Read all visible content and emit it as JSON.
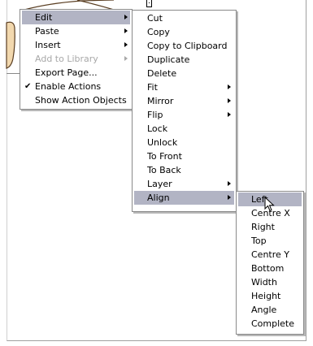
{
  "main_menu": {
    "items": [
      {
        "label": "Edit",
        "has_submenu": true,
        "state": "highlighted"
      },
      {
        "label": "Paste",
        "has_submenu": true
      },
      {
        "label": "Insert",
        "has_submenu": true
      },
      {
        "label": "Add to Library",
        "has_submenu": true,
        "state": "disabled"
      },
      {
        "label": "Export Page...",
        "has_submenu": false
      },
      {
        "label": "Enable Actions",
        "has_submenu": false,
        "checked": true,
        "check_mark": "✔"
      },
      {
        "label": "Show Action Objects",
        "has_submenu": false
      }
    ]
  },
  "edit_submenu": {
    "items": [
      {
        "label": "Cut"
      },
      {
        "label": "Copy"
      },
      {
        "label": "Copy to Clipboard"
      },
      {
        "label": "Duplicate"
      },
      {
        "label": "Delete"
      },
      {
        "label": "Fit",
        "has_submenu": true
      },
      {
        "label": "Mirror",
        "has_submenu": true
      },
      {
        "label": "Flip",
        "has_submenu": true
      },
      {
        "label": "Lock"
      },
      {
        "label": "Unlock"
      },
      {
        "label": "To Front"
      },
      {
        "label": "To Back"
      },
      {
        "label": "Layer",
        "has_submenu": true
      },
      {
        "label": "Align",
        "has_submenu": true,
        "state": "highlighted"
      }
    ]
  },
  "align_submenu": {
    "items": [
      {
        "label": "Left",
        "state": "highlighted"
      },
      {
        "label": "Centre X"
      },
      {
        "label": "Right"
      },
      {
        "label": "Top"
      },
      {
        "label": "Centre Y"
      },
      {
        "label": "Bottom"
      },
      {
        "label": "Width"
      },
      {
        "label": "Height"
      },
      {
        "label": "Angle"
      },
      {
        "label": "Complete"
      }
    ]
  },
  "colors": {
    "highlight": "#b2b4c4",
    "menu_border": "#8a8a8a",
    "disabled_text": "#a8a8a8",
    "shape_fill": "#f2d8ae",
    "shape_stroke": "#5a3e22"
  },
  "icons": {
    "cursor": "arrow-pointer-icon",
    "submenu_arrow": "chevron-right-icon",
    "check": "checkmark-icon"
  }
}
